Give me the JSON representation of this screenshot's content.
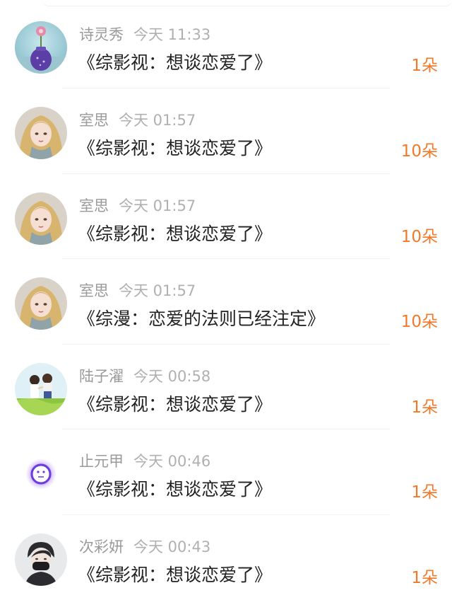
{
  "messages": [
    {
      "user": "诗灵秀",
      "time": "今天 11:33",
      "title": "《综影视：想谈恋爱了》",
      "count": "1朵",
      "avatar_icon": "flower-vase-avatar-icon"
    },
    {
      "user": "室思",
      "time": "今天 01:57",
      "title": "《综影视：想谈恋爱了》",
      "count": "10朵",
      "avatar_icon": "blonde-girl-avatar-icon"
    },
    {
      "user": "室思",
      "time": "今天 01:57",
      "title": "《综影视：想谈恋爱了》",
      "count": "10朵",
      "avatar_icon": "blonde-girl-avatar-icon"
    },
    {
      "user": "室思",
      "time": "今天 01:57",
      "title": "《综漫：恋爱的法则已经注定》",
      "count": "10朵",
      "avatar_icon": "blonde-girl-avatar-icon"
    },
    {
      "user": "陆子濯",
      "time": "今天 00:58",
      "title": "《综影视：想谈恋爱了》",
      "count": "1朵",
      "avatar_icon": "couple-avatar-icon"
    },
    {
      "user": "止元甲",
      "time": "今天 00:46",
      "title": "《综影视：想谈恋爱了》",
      "count": "1朵",
      "avatar_icon": "glowing-face-avatar-icon"
    },
    {
      "user": "次彩妍",
      "time": "今天 00:43",
      "title": "《综影视：想谈恋爱了》",
      "count": "1朵",
      "avatar_icon": "masked-boy-avatar-icon"
    }
  ],
  "colors": {
    "count": "#f07a2a",
    "title": "#222222",
    "meta": "#9a9a9a",
    "divider": "#f3f3f3"
  }
}
